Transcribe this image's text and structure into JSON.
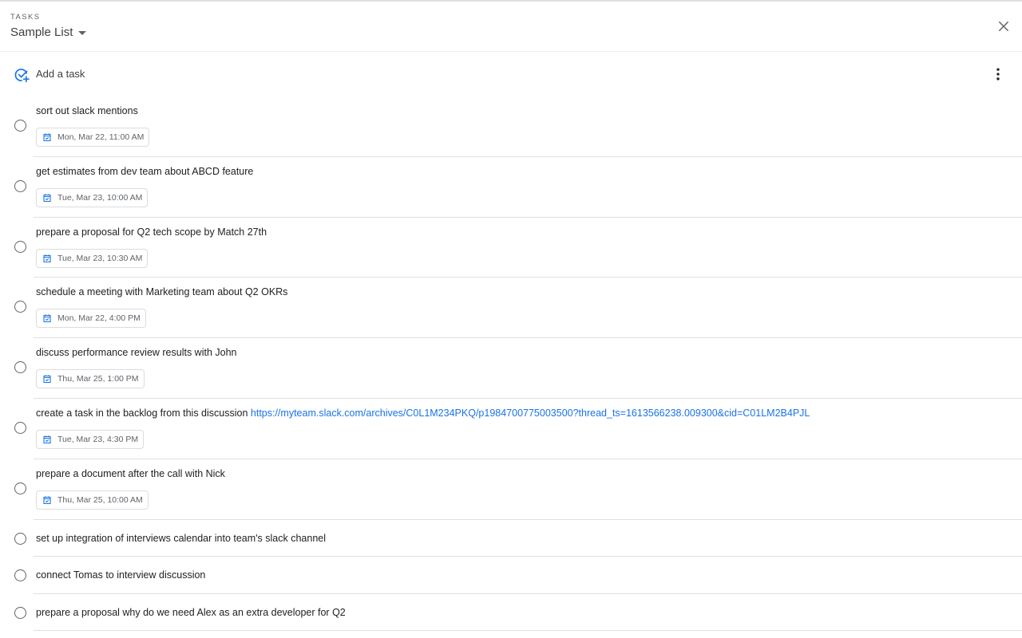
{
  "header": {
    "app_label": "TASKS",
    "list_name": "Sample List"
  },
  "add_task": {
    "label": "Add a task"
  },
  "colors": {
    "accent": "#1a73e8",
    "text": "#202124",
    "secondary_text": "#5f6368",
    "divider": "#e0e0e0"
  },
  "icons": {
    "close": "close-icon",
    "dropdown": "chevron-down-icon",
    "add": "add-task-icon",
    "more": "more-vertical-icon",
    "date": "calendar-check-icon",
    "checkbox": "circle-checkbox-icon"
  },
  "tasks": [
    {
      "title": "sort out slack mentions",
      "date": "Mon, Mar 22, 11:00 AM"
    },
    {
      "title": "get estimates from dev team about ABCD feature",
      "date": "Tue, Mar 23, 10:00 AM"
    },
    {
      "title": "prepare a proposal for Q2 tech scope by Match 27th",
      "date": "Tue, Mar 23, 10:30 AM"
    },
    {
      "title": "schedule a meeting with Marketing team about Q2 OKRs",
      "date": "Mon, Mar 22, 4:00 PM"
    },
    {
      "title": "discuss performance review results with John",
      "date": "Thu, Mar 25, 1:00 PM"
    },
    {
      "title": "create a task in the backlog from this discussion ",
      "link": "https://myteam.slack.com/archives/C0L1M234PKQ/p1984700775003500?thread_ts=1613566238.009300&cid=C01LM2B4PJL",
      "date": "Tue, Mar 23, 4:30 PM"
    },
    {
      "title": "prepare a document after the call with Nick",
      "date": "Thu, Mar 25, 10:00 AM"
    },
    {
      "title": "set up integration of interviews calendar into team's slack channel"
    },
    {
      "title": "connect Tomas to interview discussion"
    },
    {
      "title": "prepare a proposal why do we need Alex as an extra developer for Q2"
    }
  ]
}
